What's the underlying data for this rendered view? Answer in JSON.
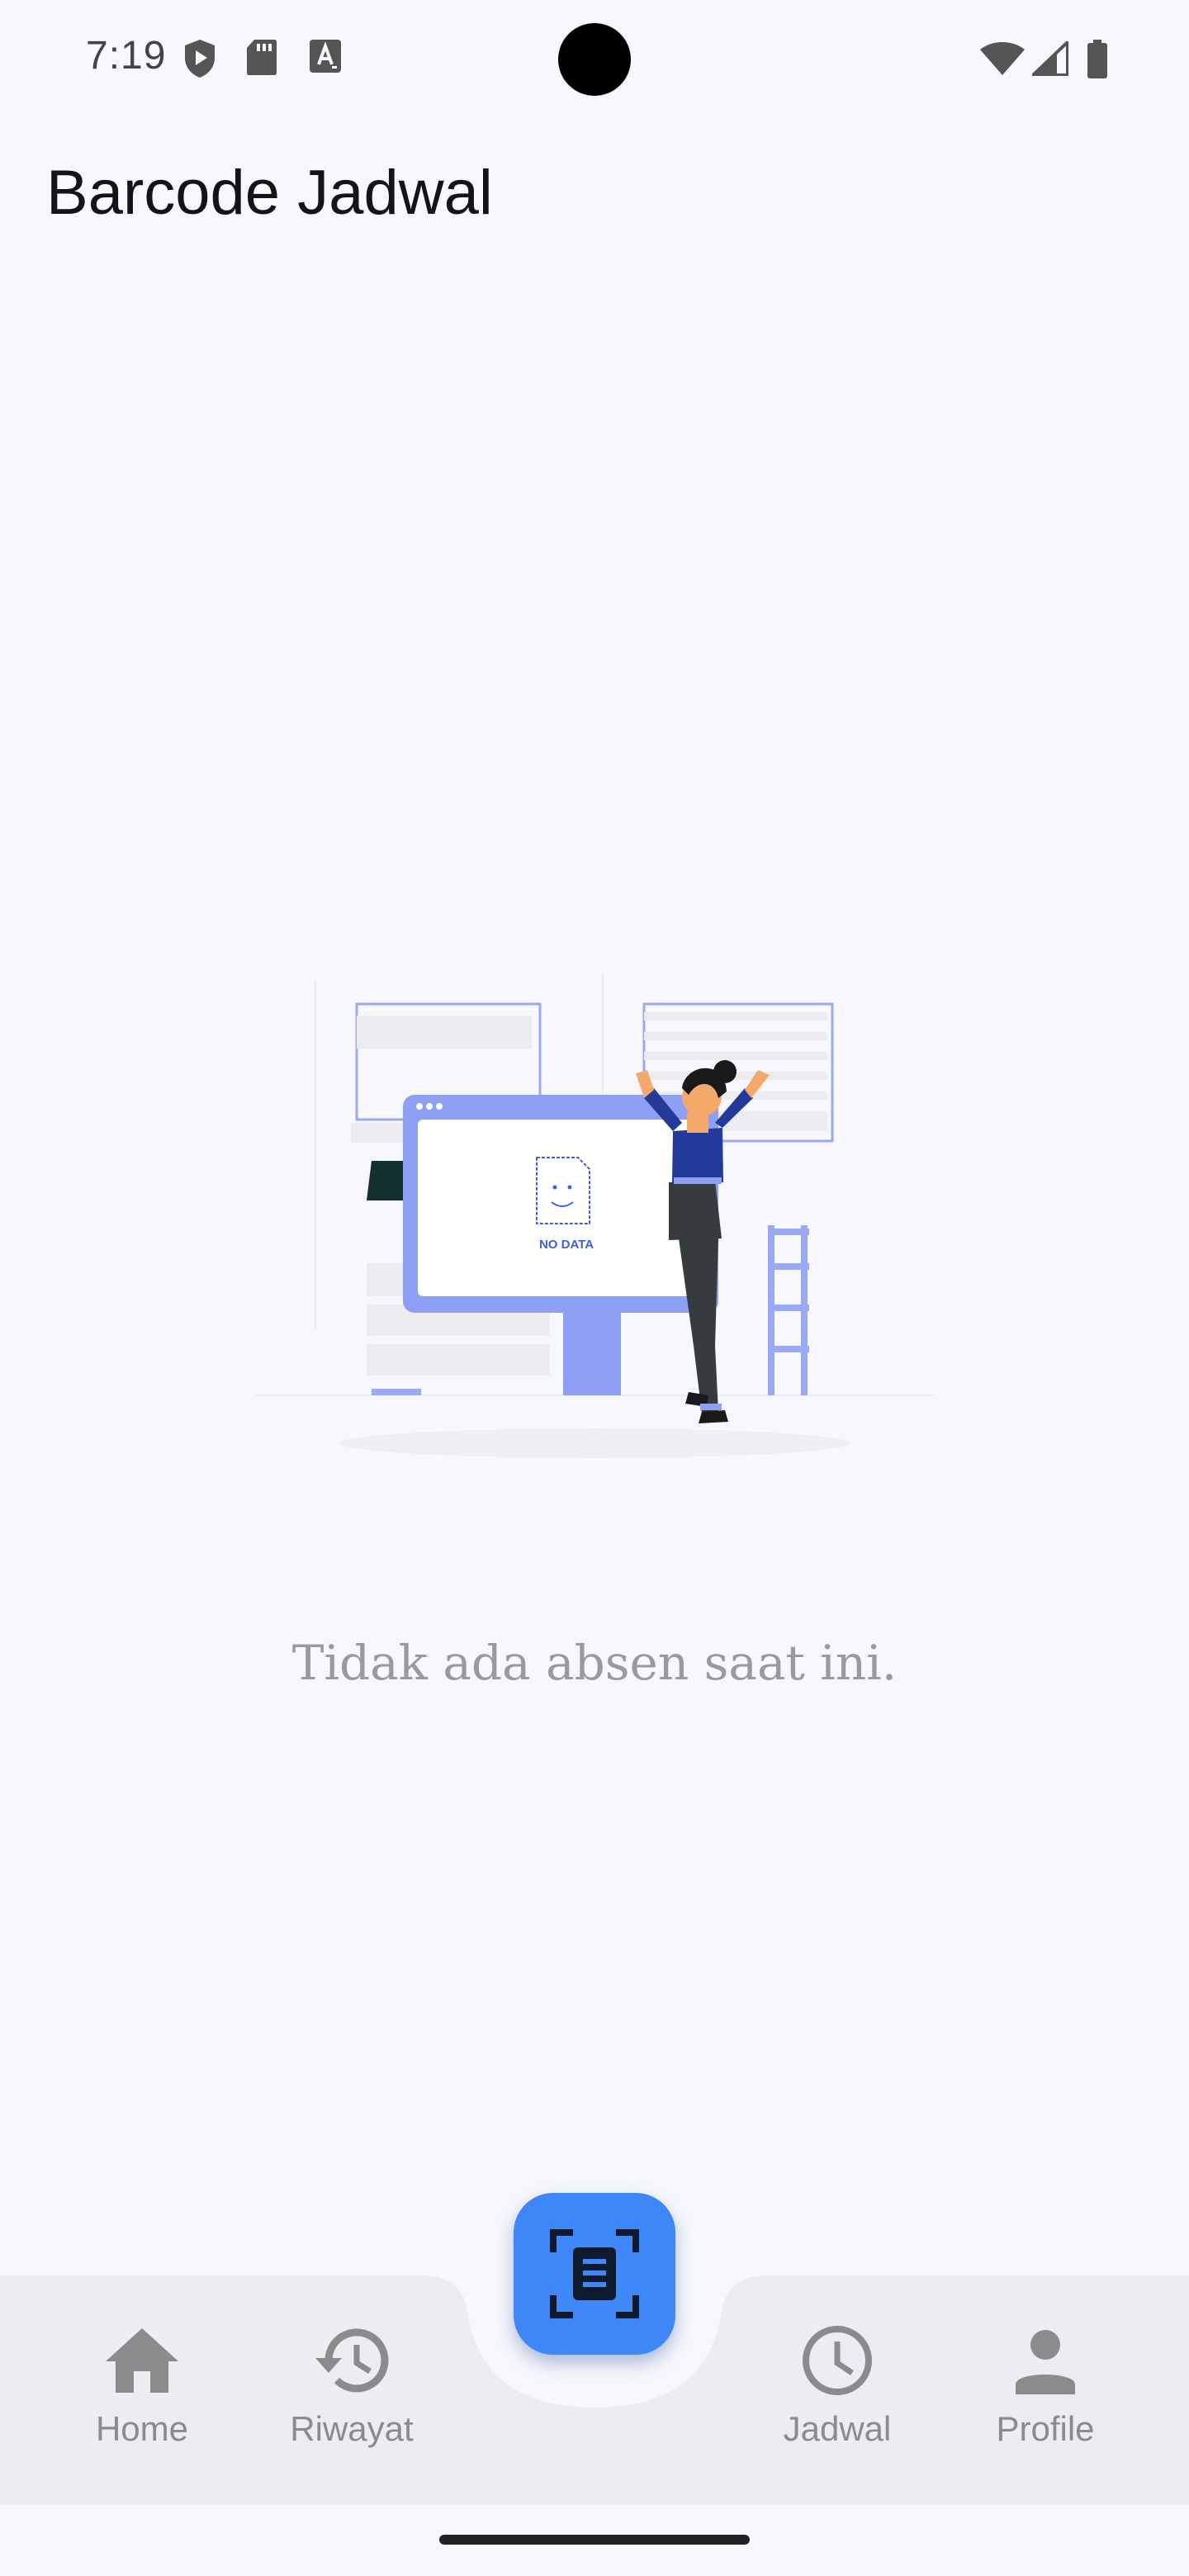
{
  "status_bar": {
    "time": "7:19",
    "left_icons": [
      "shield-play-icon",
      "sd-card-icon",
      "keyboard-a-icon"
    ],
    "right_icons": [
      "wifi-icon",
      "cell-signal-icon",
      "battery-icon"
    ]
  },
  "app_bar": {
    "title": "Barcode Jadwal"
  },
  "empty_state": {
    "illustration_label": "NO DATA",
    "message": "Tidak ada absen saat ini."
  },
  "bottom_nav": {
    "items": [
      {
        "label": "Home",
        "icon": "home-icon"
      },
      {
        "label": "Riwayat",
        "icon": "history-icon"
      },
      {
        "label": "Jadwal",
        "icon": "clock-icon"
      },
      {
        "label": "Profile",
        "icon": "person-icon"
      }
    ],
    "fab_icon": "barcode-scan-icon"
  },
  "colors": {
    "background": "#f7f8fd",
    "nav_background": "#ecedf2",
    "fab": "#3e87f7",
    "nav_inactive": "#8b8b8b",
    "illustration_accent": "#8ea0f3",
    "illustration_dark": "#243a9a"
  }
}
